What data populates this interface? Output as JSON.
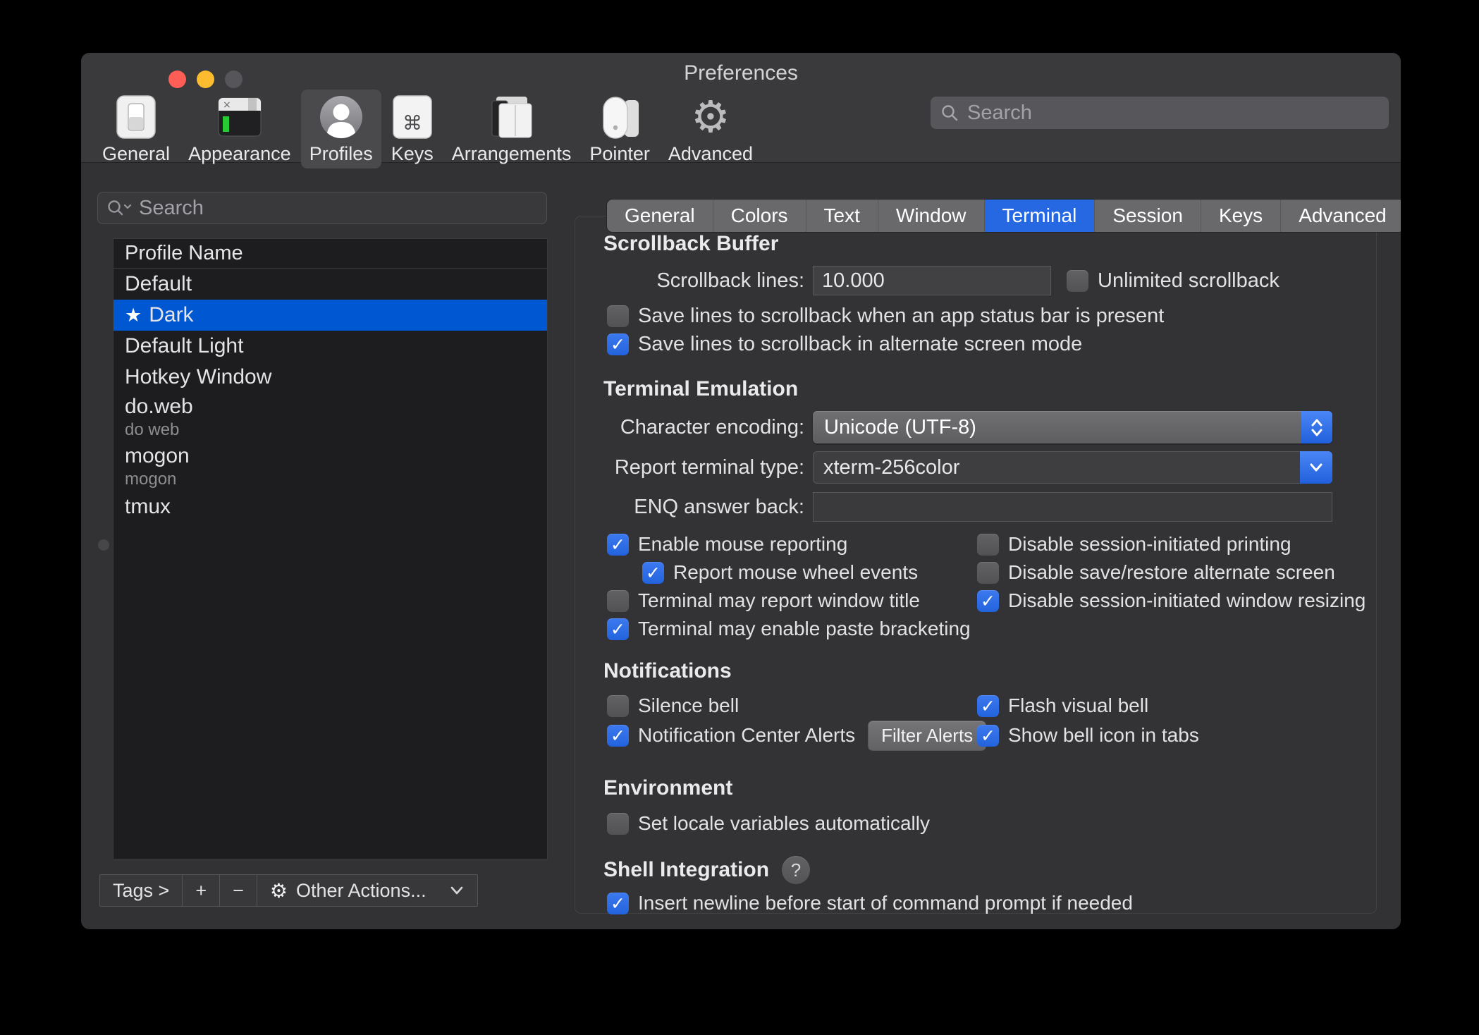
{
  "window": {
    "title": "Preferences"
  },
  "toolbar": {
    "items": [
      {
        "label": "General",
        "selected": false
      },
      {
        "label": "Appearance",
        "selected": false
      },
      {
        "label": "Profiles",
        "selected": true
      },
      {
        "label": "Keys",
        "selected": false
      },
      {
        "label": "Arrangements",
        "selected": false
      },
      {
        "label": "Pointer",
        "selected": false
      },
      {
        "label": "Advanced",
        "selected": false
      }
    ],
    "search": {
      "placeholder": "Search",
      "value": ""
    }
  },
  "sidebar": {
    "search": {
      "placeholder": "Search",
      "value": ""
    },
    "table_header": "Profile Name",
    "profiles": [
      {
        "name": "Default",
        "subtitle": "",
        "starred": false,
        "selected": false
      },
      {
        "name": "Dark",
        "subtitle": "",
        "starred": true,
        "selected": true
      },
      {
        "name": "Default Light",
        "subtitle": "",
        "starred": false,
        "selected": false
      },
      {
        "name": "Hotkey Window",
        "subtitle": "",
        "starred": false,
        "selected": false
      },
      {
        "name": "do.web",
        "subtitle": "do web",
        "starred": false,
        "selected": false
      },
      {
        "name": "mogon",
        "subtitle": "mogon",
        "starred": false,
        "selected": false
      },
      {
        "name": "tmux",
        "subtitle": "",
        "starred": false,
        "selected": false
      }
    ],
    "footer": {
      "tags_label": "Tags >",
      "add_label": "+",
      "remove_label": "−",
      "gear_glyph": "⚙",
      "other_actions_label": "Other Actions..."
    }
  },
  "tabs": {
    "items": [
      {
        "label": "General",
        "selected": false
      },
      {
        "label": "Colors",
        "selected": false
      },
      {
        "label": "Text",
        "selected": false
      },
      {
        "label": "Window",
        "selected": false
      },
      {
        "label": "Terminal",
        "selected": true
      },
      {
        "label": "Session",
        "selected": false
      },
      {
        "label": "Keys",
        "selected": false
      },
      {
        "label": "Advanced",
        "selected": false
      }
    ]
  },
  "panel": {
    "scrollback": {
      "heading": "Scrollback Buffer",
      "lines_label": "Scrollback lines:",
      "lines_value": "10.000",
      "unlimited": {
        "label": "Unlimited scrollback",
        "checked": false
      },
      "save_status_bar": {
        "label": "Save lines to scrollback when an app status bar is present",
        "checked": false
      },
      "save_alternate": {
        "label": "Save lines to scrollback in alternate screen mode",
        "checked": true
      }
    },
    "emulation": {
      "heading": "Terminal Emulation",
      "encoding_label": "Character encoding:",
      "encoding_value": "Unicode (UTF-8)",
      "terminal_type_label": "Report terminal type:",
      "terminal_type_value": "xterm-256color",
      "enq_label": "ENQ answer back:",
      "enq_value": "",
      "mouse_reporting": {
        "label": "Enable mouse reporting",
        "checked": true
      },
      "mouse_wheel": {
        "label": "Report mouse wheel events",
        "checked": true
      },
      "report_window_title": {
        "label": "Terminal may report window title",
        "checked": false
      },
      "paste_bracketing": {
        "label": "Terminal may enable paste bracketing",
        "checked": true
      },
      "disable_printing": {
        "label": "Disable session-initiated printing",
        "checked": false
      },
      "disable_alternate": {
        "label": "Disable save/restore alternate screen",
        "checked": false
      },
      "disable_resizing": {
        "label": "Disable session-initiated window resizing",
        "checked": true
      }
    },
    "notifications": {
      "heading": "Notifications",
      "silence_bell": {
        "label": "Silence bell",
        "checked": false
      },
      "flash_bell": {
        "label": "Flash visual bell",
        "checked": true
      },
      "nc_alerts": {
        "label": "Notification Center Alerts",
        "checked": true
      },
      "filter_alerts_label": "Filter Alerts",
      "bell_icon_tabs": {
        "label": "Show bell icon in tabs",
        "checked": true
      }
    },
    "environment": {
      "heading": "Environment",
      "locale": {
        "label": "Set locale variables automatically",
        "checked": false
      }
    },
    "shell": {
      "heading": "Shell Integration",
      "help_label": "?",
      "insert_newline": {
        "label": "Insert newline before start of command prompt if needed",
        "checked": true
      }
    }
  },
  "colors": {
    "accent_blue": "#2667e2",
    "selection_blue": "#0057d2",
    "traffic_red": "#ff5e57",
    "traffic_yellow": "#fdbc2f",
    "window_bg": "#323234",
    "list_bg": "#1d1d20"
  }
}
